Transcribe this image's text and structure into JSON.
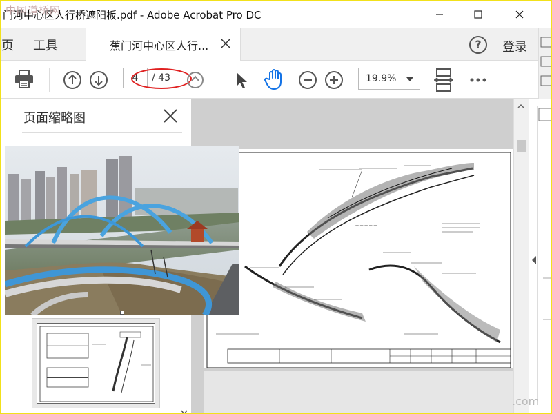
{
  "watermark": "中国道桥网",
  "window": {
    "title": "门河中心区人行桥遮阳板.pdf - Adobe Acrobat Pro DC"
  },
  "menu": {
    "home_partial": "页",
    "tools": "工具",
    "doc_tab": "蕉门河中心区人行...",
    "help_symbol": "?",
    "login": "登录"
  },
  "toolbar": {
    "current_page": "4",
    "total_pages": "/ 43",
    "zoom": "19.9%"
  },
  "side_panel": {
    "title": "页面缩略图"
  },
  "footer_partial": ".com",
  "colors": {
    "accent": "#1473e6",
    "highlight": "#e02020",
    "frame": "#f2e11a"
  }
}
